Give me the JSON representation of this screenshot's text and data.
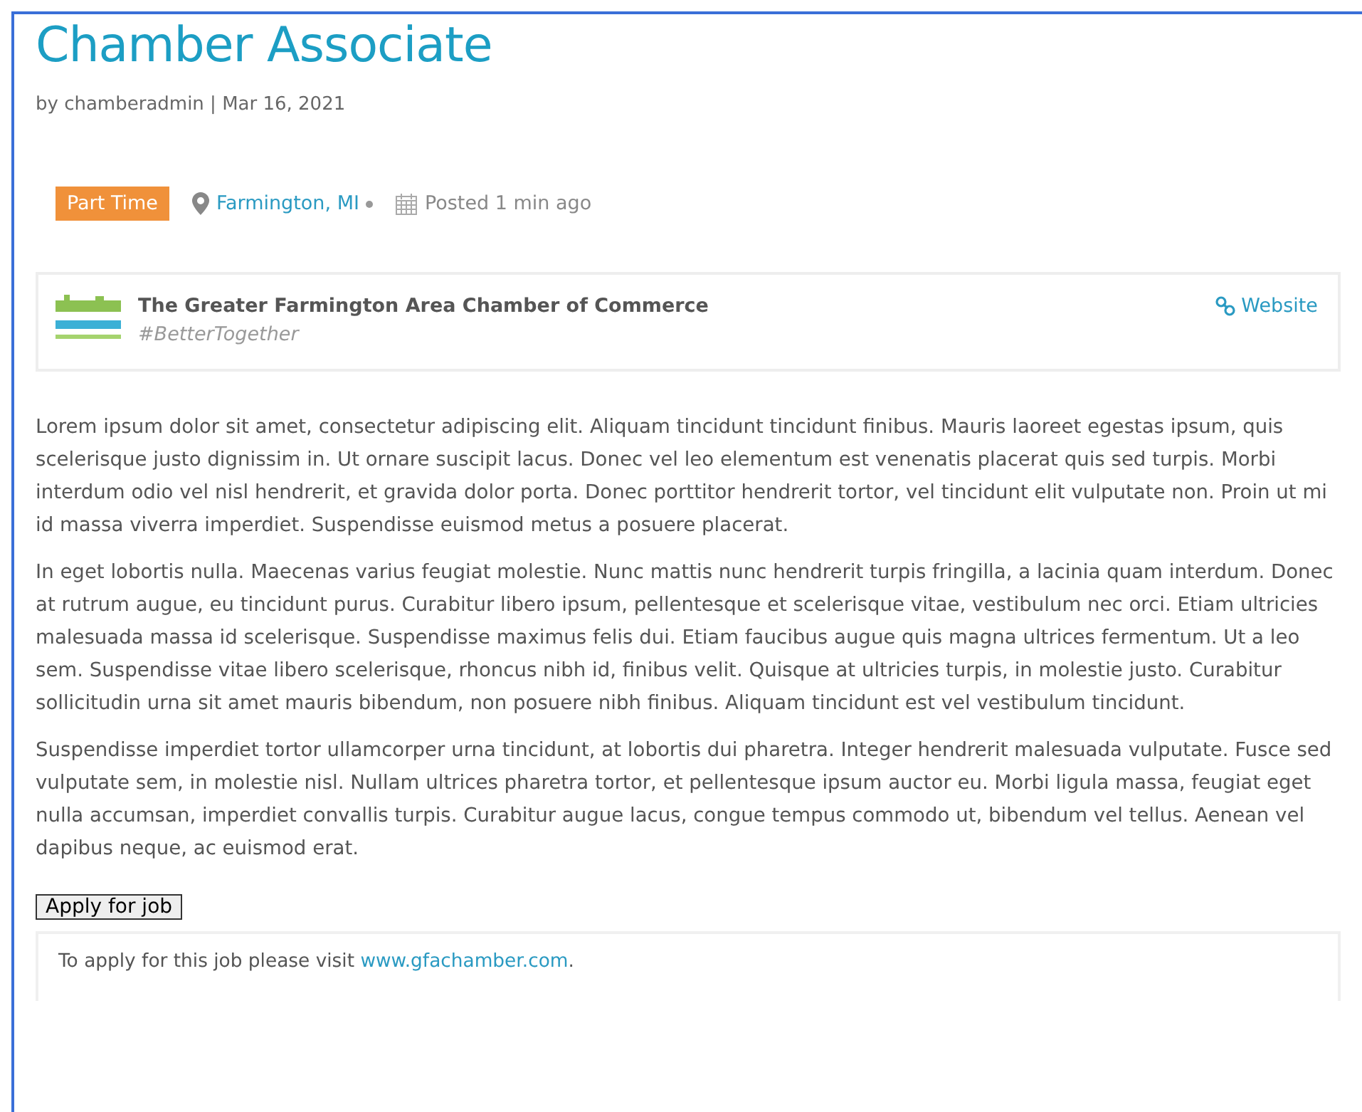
{
  "title": "Chamber Associate",
  "byline": "by chamberadmin | Mar 16, 2021",
  "job_meta": {
    "job_type": "Part Time",
    "location": "Farmington, MI",
    "posted": "Posted 1 min ago"
  },
  "company": {
    "name": "The Greater Farmington Area Chamber of Commerce",
    "tagline": "#BetterTogether",
    "website": "Website"
  },
  "paragraphs": [
    "Lorem ipsum dolor sit amet, consectetur adipiscing elit. Aliquam tincidunt tincidunt finibus. Mauris laoreet egestas ipsum, quis scelerisque justo dignissim in. Ut ornare suscipit lacus. Donec vel leo elementum est venenatis placerat quis sed turpis. Morbi interdum odio vel nisl hendrerit, et gravida dolor porta. Donec porttitor hendrerit tortor, vel tincidunt elit vulputate non. Proin ut mi id massa viverra imperdiet. Suspendisse euismod metus a posuere placerat.",
    "In eget lobortis nulla. Maecenas varius feugiat molestie. Nunc mattis nunc hendrerit turpis fringilla, a lacinia quam interdum. Donec at rutrum augue, eu tincidunt purus. Curabitur libero ipsum, pellentesque et scelerisque vitae, vestibulum nec orci. Etiam ultricies malesuada massa id scelerisque. Suspendisse maximus felis dui. Etiam faucibus augue quis magna ultrices fermentum. Ut a leo sem. Suspendisse vitae libero scelerisque, rhoncus nibh id, finibus velit. Quisque at ultricies turpis, in molestie justo. Curabitur sollicitudin urna sit amet mauris bibendum, non posuere nibh finibus. Aliquam tincidunt est vel vestibulum tincidunt.",
    "Suspendisse imperdiet tortor ullamcorper urna tincidunt, at lobortis dui pharetra. Integer hendrerit malesuada vulputate. Fusce sed vulputate sem, in molestie nisl. Nullam ultrices pharetra tortor, et pellentesque ipsum auctor eu. Morbi ligula massa, feugiat eget nulla accumsan, imperdiet convallis turpis. Curabitur augue lacus, congue tempus commodo ut, bibendum vel tellus. Aenean vel dapibus neque, ac euismod erat."
  ],
  "apply": {
    "button": "Apply for job",
    "text": "To apply for this job please visit",
    "link": "www.gfachamber.com",
    "after": "."
  }
}
